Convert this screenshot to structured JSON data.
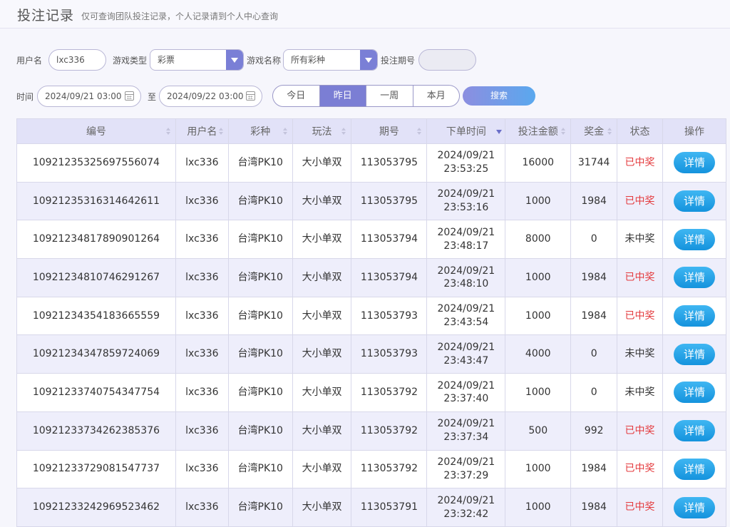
{
  "header": {
    "title": "投注记录",
    "subtitle": "仅可查询团队投注记录，个人记录请到个人中心查询"
  },
  "filters": {
    "username_label": "用户名",
    "username_value": "lxc336",
    "game_type_label": "游戏类型",
    "game_type_value": "彩票",
    "game_name_label": "游戏名称",
    "game_name_value": "所有彩种",
    "issue_label": "投注期号",
    "issue_value": "",
    "time_label": "时间",
    "date_from": "2024/09/21 03:00",
    "to_label": "至",
    "date_to": "2024/09/22 03:00",
    "quick_ranges": [
      "今日",
      "昨日",
      "一周",
      "本月"
    ],
    "active_range": "昨日",
    "search_label": "搜索"
  },
  "table": {
    "columns": [
      "编号",
      "用户名",
      "彩种",
      "玩法",
      "期号",
      "下单时间",
      "投注金额",
      "奖金",
      "状态",
      "操作"
    ],
    "detail_label": "详情",
    "rows": [
      {
        "id": "10921235325697556074",
        "user": "lxc336",
        "lottery": "台湾PK10",
        "play": "大小单双",
        "issue": "113053795",
        "date": "2024/09/21",
        "time": "23:53:25",
        "amount": "16000",
        "prize": "31744",
        "status": "已中奖"
      },
      {
        "id": "10921235316314642611",
        "user": "lxc336",
        "lottery": "台湾PK10",
        "play": "大小单双",
        "issue": "113053795",
        "date": "2024/09/21",
        "time": "23:53:16",
        "amount": "1000",
        "prize": "1984",
        "status": "已中奖"
      },
      {
        "id": "10921234817890901264",
        "user": "lxc336",
        "lottery": "台湾PK10",
        "play": "大小单双",
        "issue": "113053794",
        "date": "2024/09/21",
        "time": "23:48:17",
        "amount": "8000",
        "prize": "0",
        "status": "未中奖"
      },
      {
        "id": "10921234810746291267",
        "user": "lxc336",
        "lottery": "台湾PK10",
        "play": "大小单双",
        "issue": "113053794",
        "date": "2024/09/21",
        "time": "23:48:10",
        "amount": "1000",
        "prize": "1984",
        "status": "已中奖"
      },
      {
        "id": "10921234354183665559",
        "user": "lxc336",
        "lottery": "台湾PK10",
        "play": "大小单双",
        "issue": "113053793",
        "date": "2024/09/21",
        "time": "23:43:54",
        "amount": "1000",
        "prize": "1984",
        "status": "已中奖"
      },
      {
        "id": "10921234347859724069",
        "user": "lxc336",
        "lottery": "台湾PK10",
        "play": "大小单双",
        "issue": "113053793",
        "date": "2024/09/21",
        "time": "23:43:47",
        "amount": "4000",
        "prize": "0",
        "status": "未中奖"
      },
      {
        "id": "10921233740754347754",
        "user": "lxc336",
        "lottery": "台湾PK10",
        "play": "大小单双",
        "issue": "113053792",
        "date": "2024/09/21",
        "time": "23:37:40",
        "amount": "1000",
        "prize": "0",
        "status": "未中奖"
      },
      {
        "id": "10921233734262385376",
        "user": "lxc336",
        "lottery": "台湾PK10",
        "play": "大小单双",
        "issue": "113053792",
        "date": "2024/09/21",
        "time": "23:37:34",
        "amount": "500",
        "prize": "992",
        "status": "已中奖"
      },
      {
        "id": "10921233729081547737",
        "user": "lxc336",
        "lottery": "台湾PK10",
        "play": "大小单双",
        "issue": "113053792",
        "date": "2024/09/21",
        "time": "23:37:29",
        "amount": "1000",
        "prize": "1984",
        "status": "已中奖"
      },
      {
        "id": "10921233242969523462",
        "user": "lxc336",
        "lottery": "台湾PK10",
        "play": "大小单双",
        "issue": "113053791",
        "date": "2024/09/21",
        "time": "23:32:42",
        "amount": "1000",
        "prize": "1984",
        "status": "已中奖"
      }
    ]
  },
  "colors": {
    "accent": "#7b7ed4",
    "won": "#e4393c",
    "detail_button": "#1c9ce3"
  }
}
